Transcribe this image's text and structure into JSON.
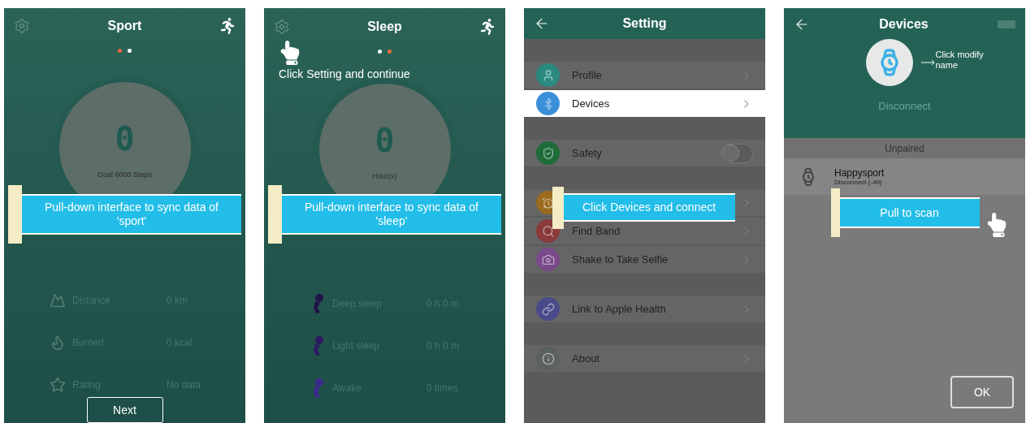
{
  "screens": [
    {
      "kind": "dashboard",
      "title": "Sport",
      "page_dots": [
        {
          "selected": true
        },
        {
          "selected": false
        }
      ],
      "value": "0",
      "caption": "Goal 8000 Steps",
      "banner": "Pull-down interface to sync data of 'sport'",
      "stats": [
        {
          "label": "Distance",
          "value": "0 km"
        },
        {
          "label": "Burned",
          "value": "0 kcal"
        },
        {
          "label": "Rating",
          "value": "No data"
        }
      ],
      "button": "Next"
    },
    {
      "kind": "dashboard",
      "title": "Sleep",
      "hint": "Click Setting and continue",
      "page_dots": [
        {
          "selected": false
        },
        {
          "selected": true
        }
      ],
      "value": "0",
      "caption": "Hour(s)",
      "banner": "Pull-down interface to sync data of 'sleep'",
      "stats": [
        {
          "label": "Deep sleep",
          "value": "0 h 0 m",
          "color": "#1e1446"
        },
        {
          "label": "Light sleep",
          "value": "0 h 0 m",
          "color": "#2c1a63"
        },
        {
          "label": "Awake",
          "value": "0 times",
          "color": "#3b2a8a"
        }
      ]
    },
    {
      "kind": "settings",
      "title": "Setting",
      "banner": "Click Devices and connect",
      "groups": [
        [
          {
            "kind": "link",
            "label": "Profile",
            "color": "#2a8a80",
            "selected": false
          },
          {
            "kind": "link",
            "label": "Devices",
            "color": "#3b8fd9",
            "selected": true
          }
        ],
        [
          {
            "kind": "toggle",
            "label": "Safety",
            "color": "#1f6b3a",
            "on": false,
            "selected": false
          }
        ],
        [
          {
            "kind": "link",
            "color": "#9a6a1e",
            "selected": false
          },
          {
            "kind": "link",
            "label": "Find Band",
            "color": "#8a3a3a",
            "selected": false
          },
          {
            "kind": "link",
            "label": "Shake to Take Selfie",
            "color": "#7a4a8a",
            "selected": false
          }
        ],
        [
          {
            "kind": "link",
            "label": "Link to Apple Health",
            "color": "#4a4a8a",
            "selected": false
          }
        ],
        [
          {
            "kind": "link",
            "label": "About",
            "color": "#5a6260",
            "selected": false
          }
        ]
      ]
    },
    {
      "kind": "devices",
      "title": "Devices",
      "hint": "Click modify name",
      "status": "Disconnect",
      "section": "Unpaired",
      "devices": [
        {
          "name": "Happysport",
          "status": "Disconnect (-49)"
        }
      ],
      "banner": "Pull to scan",
      "button": "OK"
    }
  ]
}
